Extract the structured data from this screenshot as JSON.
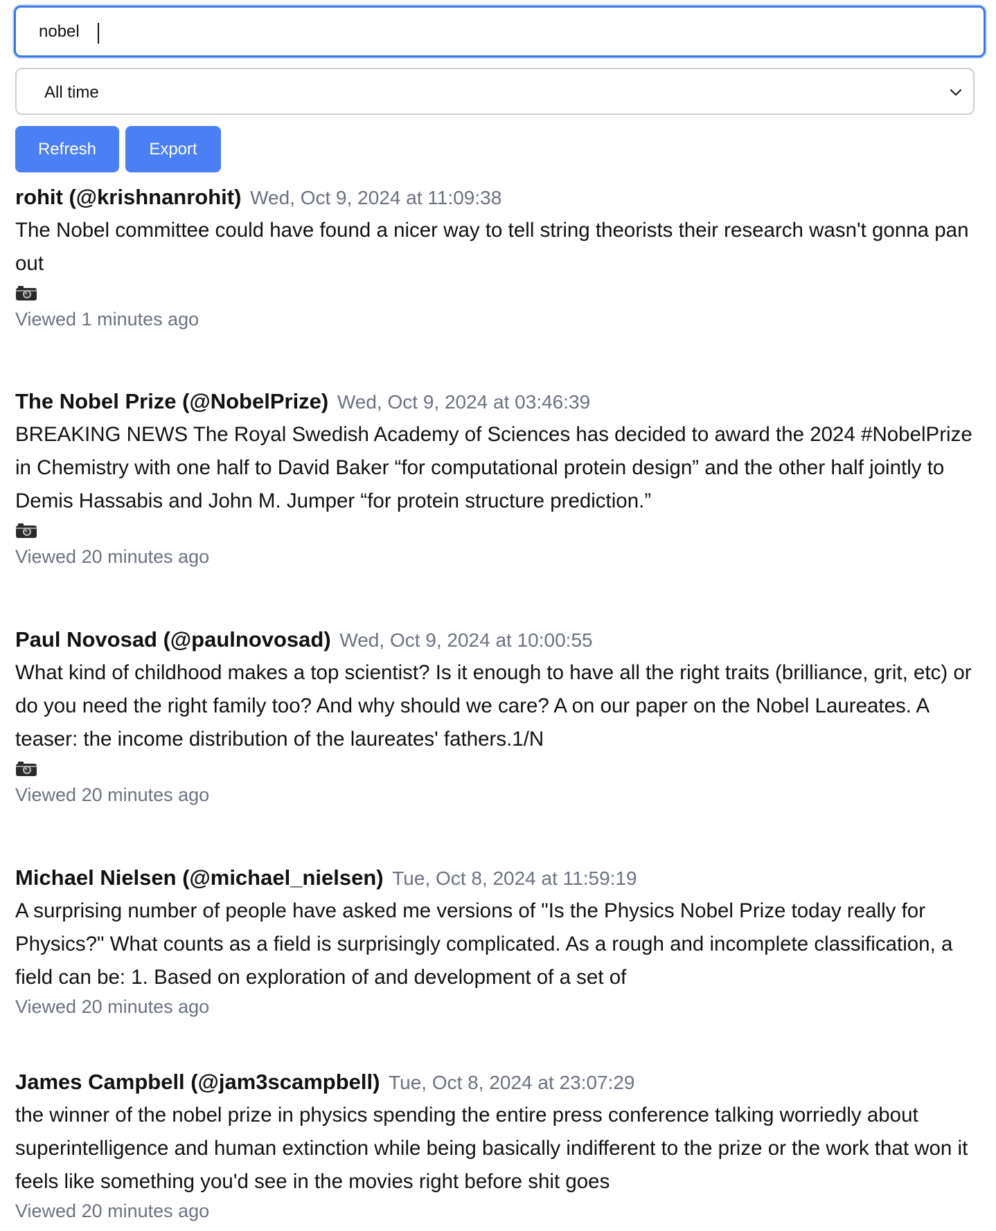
{
  "search": {
    "value": "nobel",
    "icon": "text-caret"
  },
  "filter": {
    "selected": "All time",
    "icon": "chevron-down-icon"
  },
  "toolbar": {
    "refresh_label": "Refresh",
    "export_label": "Export",
    "button_color": "#4a7ff5"
  },
  "posts": [
    {
      "author": "rohit (@krishnanrohit)",
      "timestamp": "Wed, Oct 9, 2024 at 11:09:38",
      "text": "The Nobel committee could have found a nicer way to tell string theorists their research wasn't gonna pan out",
      "has_media": true,
      "viewed": "Viewed 1 minutes ago"
    },
    {
      "author": "The Nobel Prize (@NobelPrize)",
      "timestamp": "Wed, Oct 9, 2024 at 03:46:39",
      "text": "BREAKING NEWS The Royal Swedish Academy of Sciences has decided to award the 2024 #NobelPrize in Chemistry with one half to David Baker “for computational protein design” and the other half jointly to Demis Hassabis and John M. Jumper “for protein structure prediction.”",
      "has_media": true,
      "viewed": "Viewed 20 minutes ago"
    },
    {
      "author": "Paul Novosad (@paulnovosad)",
      "timestamp": "Wed, Oct 9, 2024 at 10:00:55",
      "text": "What kind of childhood makes a top scientist? Is it enough to have all the right traits (brilliance, grit, etc) or do you need the right family too? And why should we care? A on our paper on the Nobel Laureates. A teaser: the income distribution of the laureates' fathers.1/N",
      "has_media": true,
      "viewed": "Viewed 20 minutes ago"
    },
    {
      "author": "Michael Nielsen (@michael_nielsen)",
      "timestamp": "Tue, Oct 8, 2024 at 11:59:19",
      "text": "A surprising number of people have asked me versions of \"Is the Physics Nobel Prize today really for Physics?\" What counts as a field is surprisingly complicated. As a rough and incomplete classification, a field can be: 1. Based on exploration of and development of a set of",
      "has_media": false,
      "viewed": "Viewed 20 minutes ago"
    },
    {
      "author": "James Campbell (@jam3scampbell)",
      "timestamp": "Tue, Oct 8, 2024 at 23:07:29",
      "text": "the winner of the nobel prize in physics spending the entire press conference talking worriedly about superintelligence and human extinction while being basically indifferent to the prize or the work that won it feels like something you'd see in the movies right before shit goes",
      "has_media": false,
      "viewed": "Viewed 20 minutes ago"
    }
  ],
  "colors": {
    "focus_border": "#3b78e7",
    "muted_text": "#6b7280"
  }
}
